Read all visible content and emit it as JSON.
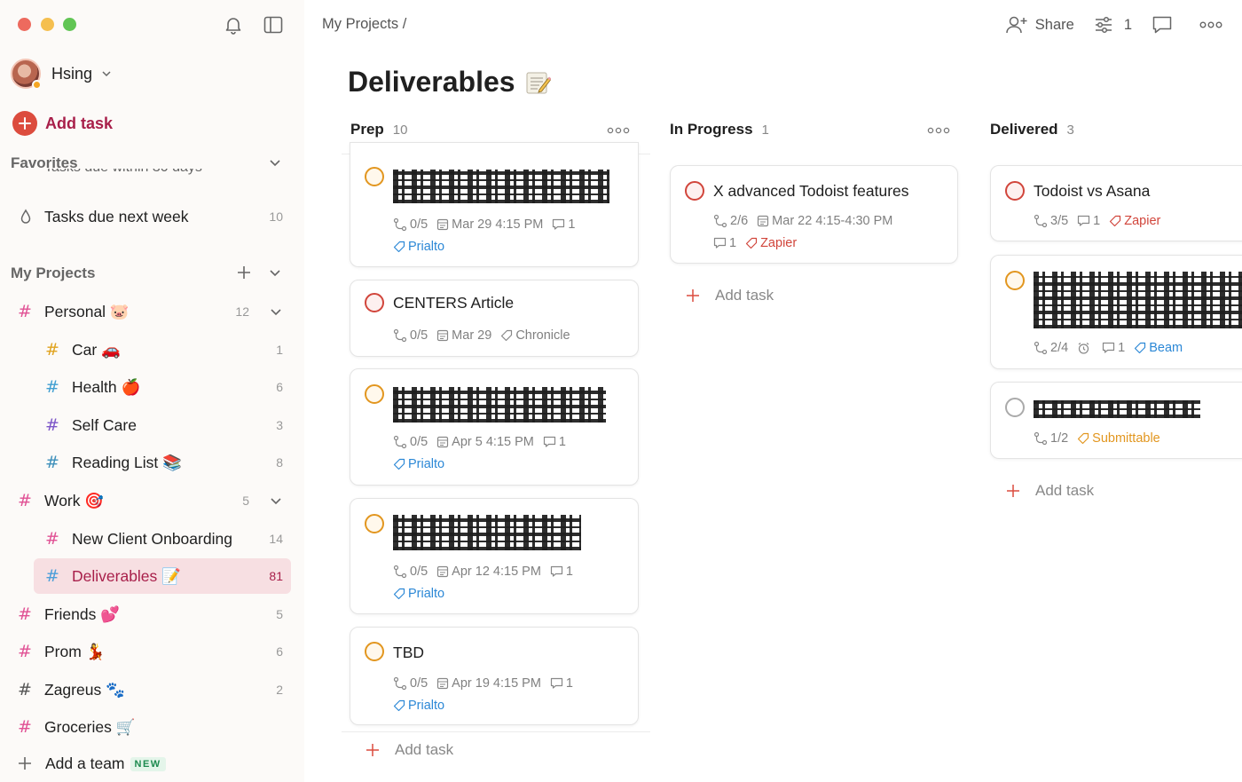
{
  "sidebar": {
    "user_name": "Hsing",
    "add_task_label": "Add task",
    "favorites_title": "Favorites",
    "favorites_clipped": "Tasks due within 30 days",
    "favorites": [
      {
        "label": "Tasks due next week",
        "count": "10"
      }
    ],
    "projects_title": "My Projects",
    "projects": [
      {
        "label": "Personal 🐷",
        "count": "12",
        "level": 0,
        "color": "#e05194"
      },
      {
        "label": "Car 🚗",
        "count": "1",
        "level": 1,
        "color": "#e0a31f"
      },
      {
        "label": "Health 🍎",
        "count": "6",
        "level": 1,
        "color": "#419fd1"
      },
      {
        "label": "Self Care",
        "count": "3",
        "level": 1,
        "color": "#7d56c8"
      },
      {
        "label": "Reading List 📚",
        "count": "8",
        "level": 1,
        "color": "#3d8fba"
      },
      {
        "label": "Work 🎯",
        "count": "5",
        "level": 0,
        "color": "#e05194"
      },
      {
        "label": "New Client Onboarding",
        "count": "14",
        "level": 1,
        "color": "#e05194"
      },
      {
        "label": "Deliverables 📝",
        "count": "81",
        "level": 1,
        "color": "#4d9fd9",
        "active": true
      },
      {
        "label": "Friends 💕",
        "count": "5",
        "level": 0,
        "color": "#e05194"
      },
      {
        "label": "Prom 💃",
        "count": "6",
        "level": 0,
        "color": "#e05194"
      },
      {
        "label": "Zagreus 🐾",
        "count": "2",
        "level": 0,
        "color": "#555555"
      },
      {
        "label": "Groceries 🛒",
        "count": "",
        "level": 0,
        "color": "#e05194"
      }
    ],
    "add_team_label": "Add a team",
    "new_badge": "NEW"
  },
  "header": {
    "breadcrumb": "My Projects /",
    "share_label": "Share",
    "filter_count": "1",
    "title": "Deliverables",
    "title_emoji": "📝"
  },
  "columns": [
    {
      "name": "Prep",
      "count": "10"
    },
    {
      "name": "In Progress",
      "count": "1"
    },
    {
      "name": "Delivered",
      "count": "3"
    }
  ],
  "prep_cards": [
    {
      "title": "",
      "redacted": true,
      "check": "orange",
      "subtasks": "0/5",
      "date": "Mar 29 4:15 PM",
      "comments": "1",
      "label": "Prialto",
      "label_color": "#2c88d6"
    },
    {
      "title": "CENTERS Article",
      "redacted": false,
      "check": "red",
      "subtasks": "0/5",
      "date": "Mar 29",
      "comments": "",
      "label": "Chronicle",
      "label_color": "#808080"
    },
    {
      "title": "",
      "redacted": true,
      "check": "orange",
      "subtasks": "0/5",
      "date": "Apr 5 4:15 PM",
      "comments": "1",
      "label": "Prialto",
      "label_color": "#2c88d6"
    },
    {
      "title": "",
      "redacted": true,
      "check": "orange",
      "subtasks": "0/5",
      "date": "Apr 12 4:15 PM",
      "comments": "1",
      "label": "Prialto",
      "label_color": "#2c88d6"
    },
    {
      "title": "TBD",
      "redacted": false,
      "check": "orange",
      "subtasks": "0/5",
      "date": "Apr 19 4:15 PM",
      "comments": "1",
      "label": "Prialto",
      "label_color": "#2c88d6"
    }
  ],
  "progress_cards": [
    {
      "title": "X advanced Todoist features",
      "check": "red",
      "subtasks": "2/6",
      "date": "Mar 22 4:15-4:30 PM",
      "comments": "1",
      "label": "Zapier",
      "label_color": "#d1453b"
    }
  ],
  "delivered_cards": [
    {
      "title": "Todoist vs Asana",
      "redacted": false,
      "check": "red",
      "subtasks": "3/5",
      "comments": "1",
      "label": "Zapier",
      "label_color": "#d1453b"
    },
    {
      "title": "",
      "redacted": true,
      "check": "orange",
      "subtasks": "2/4",
      "comments": "1",
      "label": "Beam",
      "label_color": "#2c88d6"
    },
    {
      "title": "",
      "redacted": true,
      "check": "grey",
      "subtasks": "1/2",
      "comments": "",
      "label": "Submittable",
      "label_color": "#e2961f"
    }
  ],
  "add_task_label": "Add task",
  "colors": {
    "accent": "#dc4c3e",
    "add_task_text": "#a81f4a",
    "active_bg": "#f7dfe2",
    "sidebar_bg": "#fcfaf8"
  }
}
